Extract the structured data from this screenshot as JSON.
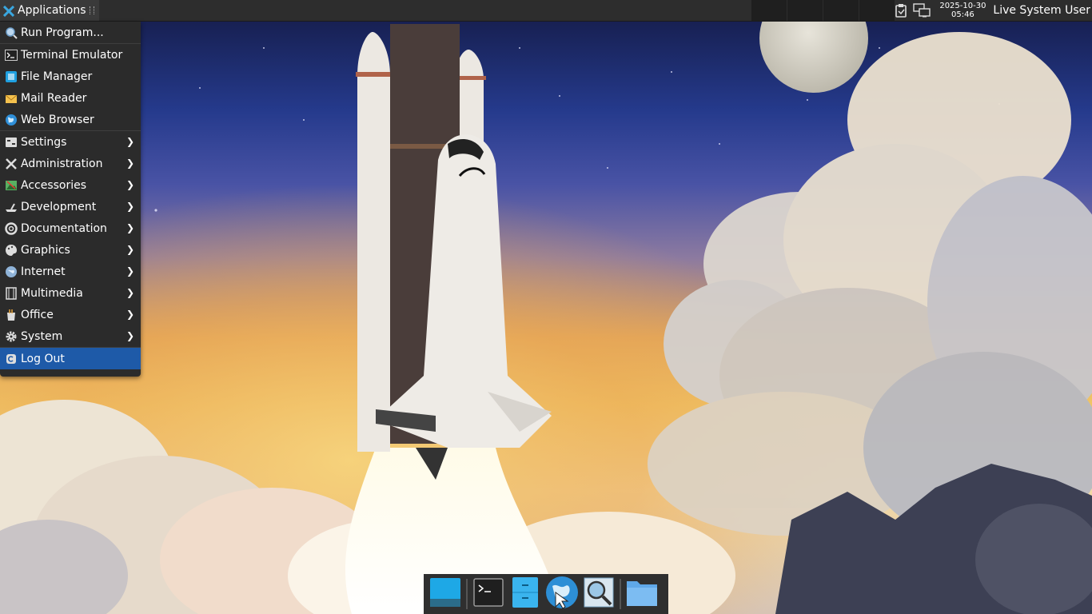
{
  "panel": {
    "applications_label": "Applications",
    "clock_date": "2025-10-30",
    "clock_time": "05:46",
    "user": "Live System User"
  },
  "menu": {
    "items": [
      {
        "label": "Run Program...",
        "icon": "search-icon",
        "submenu": false
      },
      {
        "label": "Terminal Emulator",
        "icon": "terminal-icon",
        "submenu": false
      },
      {
        "label": "File Manager",
        "icon": "file-manager-icon",
        "submenu": false
      },
      {
        "label": "Mail Reader",
        "icon": "mail-icon",
        "submenu": false
      },
      {
        "label": "Web Browser",
        "icon": "globe-icon",
        "submenu": false
      },
      {
        "label": "Settings",
        "icon": "settings-icon",
        "submenu": true
      },
      {
        "label": "Administration",
        "icon": "tools-icon",
        "submenu": true
      },
      {
        "label": "Accessories",
        "icon": "accessories-icon",
        "submenu": true
      },
      {
        "label": "Development",
        "icon": "development-icon",
        "submenu": true
      },
      {
        "label": "Documentation",
        "icon": "lifebuoy-icon",
        "submenu": true
      },
      {
        "label": "Graphics",
        "icon": "palette-icon",
        "submenu": true
      },
      {
        "label": "Internet",
        "icon": "internet-icon",
        "submenu": true
      },
      {
        "label": "Multimedia",
        "icon": "film-icon",
        "submenu": true
      },
      {
        "label": "Office",
        "icon": "office-icon",
        "submenu": true
      },
      {
        "label": "System",
        "icon": "gear-icon",
        "submenu": true
      },
      {
        "label": "Log Out",
        "icon": "logout-icon",
        "submenu": false,
        "active": true
      }
    ]
  },
  "dock": {
    "items": [
      "show-desktop-icon",
      "terminal-icon",
      "file-manager-icon",
      "web-browser-icon",
      "app-finder-icon",
      "folder-icon"
    ]
  },
  "colors": {
    "panel_bg": "#2d2d2d",
    "menu_bg": "#2b2b2b",
    "menu_highlight": "#1e5aa8",
    "dock_bg": "#2f2f2f"
  }
}
